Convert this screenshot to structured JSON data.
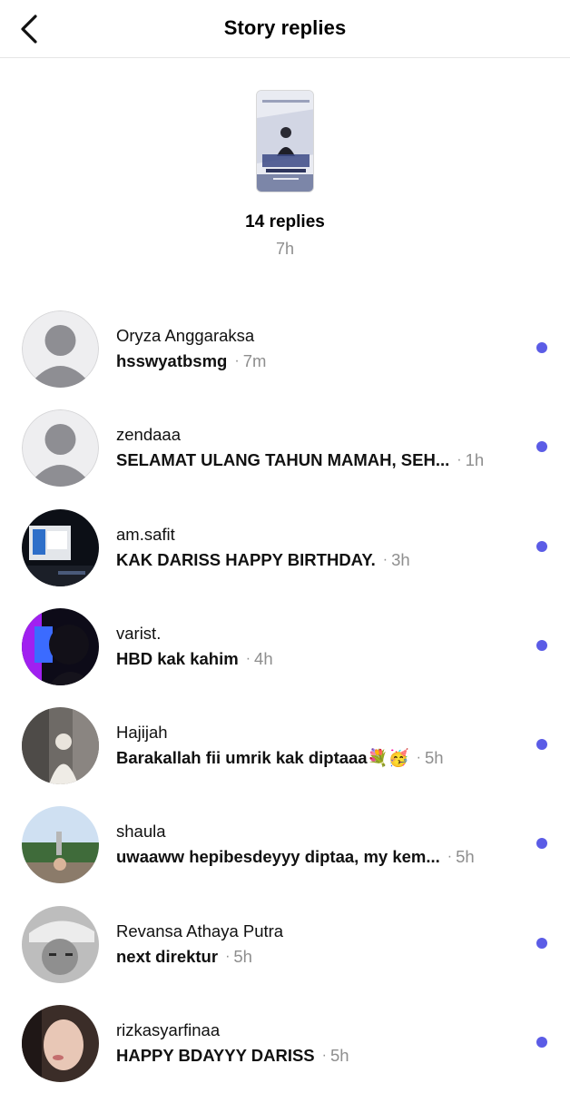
{
  "header": {
    "title": "Story replies",
    "back_icon": "chevron-left-icon"
  },
  "story": {
    "replies_count": "14 replies",
    "time": "7h"
  },
  "replies": [
    {
      "username": "Oryza Anggaraksa",
      "message": "hsswyatbsmg",
      "time": "7m",
      "unread": true,
      "avatar": "default-avatar-icon"
    },
    {
      "username": "zendaaa",
      "message": "SELAMAT ULANG TAHUN MAMAH, SEH...",
      "time": "1h",
      "unread": true,
      "avatar": "default-avatar-icon"
    },
    {
      "username": "am.safit",
      "message": "KAK DARISS HAPPY BIRTHDAY.",
      "time": "3h",
      "unread": true,
      "avatar": "photo"
    },
    {
      "username": "varist.",
      "message": "HBD kak kahim",
      "time": "4h",
      "unread": true,
      "avatar": "photo"
    },
    {
      "username": "Hajijah",
      "message": "Barakallah fii umrik kak diptaaa💐🥳",
      "time": "5h",
      "unread": true,
      "avatar": "photo"
    },
    {
      "username": "shaula",
      "message": "uwaaww hepibesdeyyy diptaa, my kem...",
      "time": "5h",
      "unread": true,
      "avatar": "photo"
    },
    {
      "username": "Revansa Athaya Putra",
      "message": "next direktur",
      "time": "5h",
      "unread": true,
      "avatar": "photo"
    },
    {
      "username": "rizkasyarfinaa",
      "message": "HAPPY BDAYYY DARISS",
      "time": "5h",
      "unread": true,
      "avatar": "photo"
    }
  ],
  "colors": {
    "unread_dot": "#5b5ce6",
    "secondary_text": "#8e8e8e",
    "divider": "#e6e6e6"
  }
}
